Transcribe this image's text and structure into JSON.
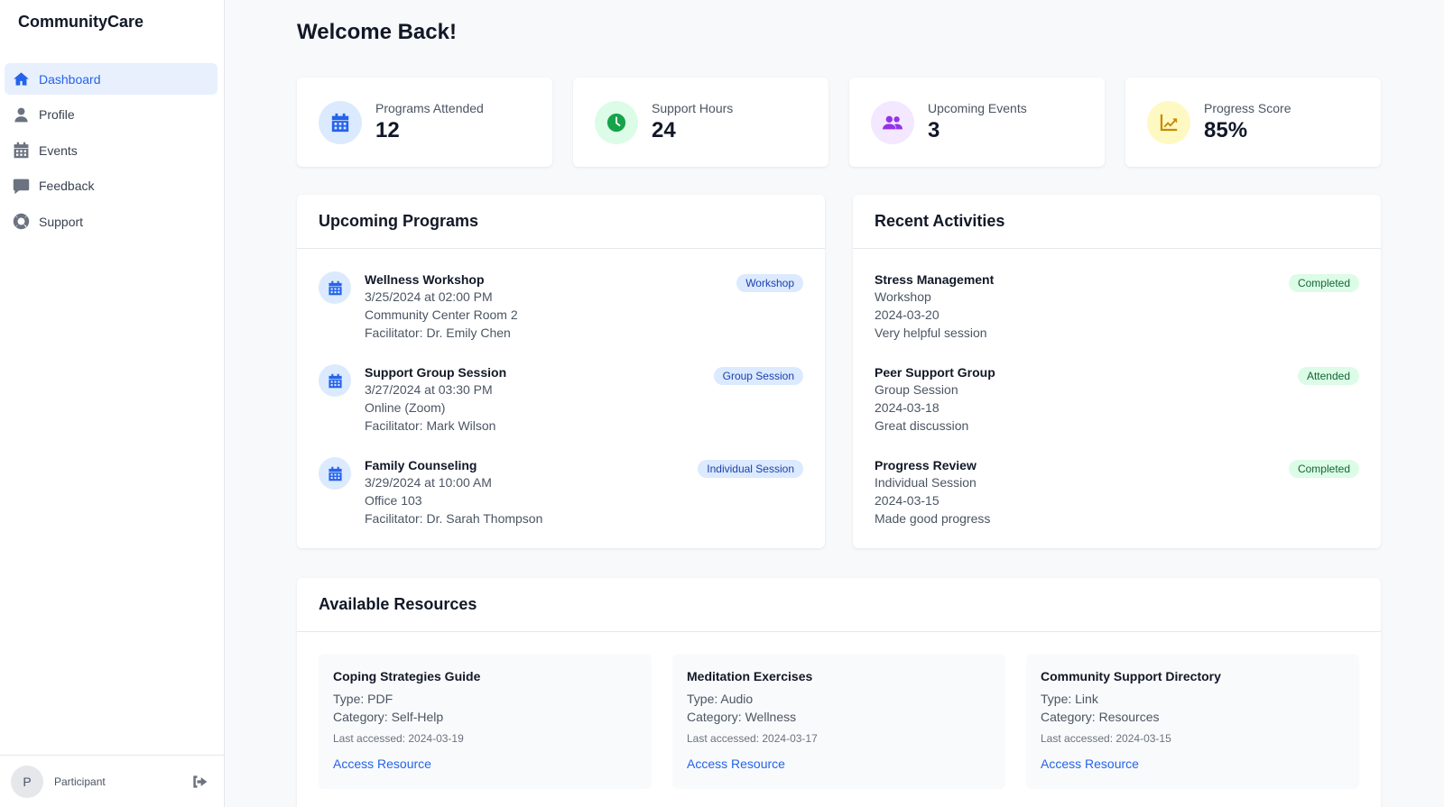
{
  "app": {
    "brand": "CommunityCare"
  },
  "sidebar": {
    "items": [
      {
        "label": "Dashboard",
        "icon": "home-icon",
        "active": true
      },
      {
        "label": "Profile",
        "icon": "user-icon"
      },
      {
        "label": "Events",
        "icon": "calendar-icon"
      },
      {
        "label": "Feedback",
        "icon": "comment-icon"
      },
      {
        "label": "Support",
        "icon": "lifering-icon"
      }
    ],
    "user": {
      "initial": "P",
      "role": "Participant",
      "logout_icon": "logout-icon"
    }
  },
  "main": {
    "title": "Welcome Back!",
    "stats": [
      {
        "label": "Programs Attended",
        "value": "12",
        "icon": "calendar-icon",
        "color": "#2563eb",
        "bg": "#dbeafe"
      },
      {
        "label": "Support Hours",
        "value": "24",
        "icon": "clock-icon",
        "color": "#16a34a",
        "bg": "#dcfce7"
      },
      {
        "label": "Upcoming Events",
        "value": "3",
        "icon": "users-icon",
        "color": "#9333ea",
        "bg": "#f3e8ff"
      },
      {
        "label": "Progress Score",
        "value": "85%",
        "icon": "chart-line-icon",
        "color": "#ca8a04",
        "bg": "#fef9c3"
      }
    ],
    "upcoming_programs": {
      "title": "Upcoming Programs",
      "items": [
        {
          "name": "Wellness Workshop",
          "datetime": "3/25/2024 at 02:00 PM",
          "location": "Community Center Room 2",
          "facilitator": "Facilitator: Dr. Emily Chen",
          "badge": "Workshop"
        },
        {
          "name": "Support Group Session",
          "datetime": "3/27/2024 at 03:30 PM",
          "location": "Online (Zoom)",
          "facilitator": "Facilitator: Mark Wilson",
          "badge": "Group Session"
        },
        {
          "name": "Family Counseling",
          "datetime": "3/29/2024 at 10:00 AM",
          "location": "Office 103",
          "facilitator": "Facilitator: Dr. Sarah Thompson",
          "badge": "Individual Session"
        }
      ]
    },
    "recent_activities": {
      "title": "Recent Activities",
      "items": [
        {
          "name": "Stress Management",
          "type": "Workshop",
          "date": "2024-03-20",
          "note": "Very helpful session",
          "status": "Completed"
        },
        {
          "name": "Peer Support Group",
          "type": "Group Session",
          "date": "2024-03-18",
          "note": "Great discussion",
          "status": "Attended"
        },
        {
          "name": "Progress Review",
          "type": "Individual Session",
          "date": "2024-03-15",
          "note": "Made good progress",
          "status": "Completed"
        }
      ]
    },
    "resources": {
      "title": "Available Resources",
      "items": [
        {
          "name": "Coping Strategies Guide",
          "type": "Type: PDF",
          "category": "Category: Self-Help",
          "accessed": "Last accessed: 2024-03-19",
          "link": "Access Resource"
        },
        {
          "name": "Meditation Exercises",
          "type": "Type: Audio",
          "category": "Category: Wellness",
          "accessed": "Last accessed: 2024-03-17",
          "link": "Access Resource"
        },
        {
          "name": "Community Support Directory",
          "type": "Type: Link",
          "category": "Category: Resources",
          "accessed": "Last accessed: 2024-03-15",
          "link": "Access Resource"
        }
      ]
    }
  }
}
